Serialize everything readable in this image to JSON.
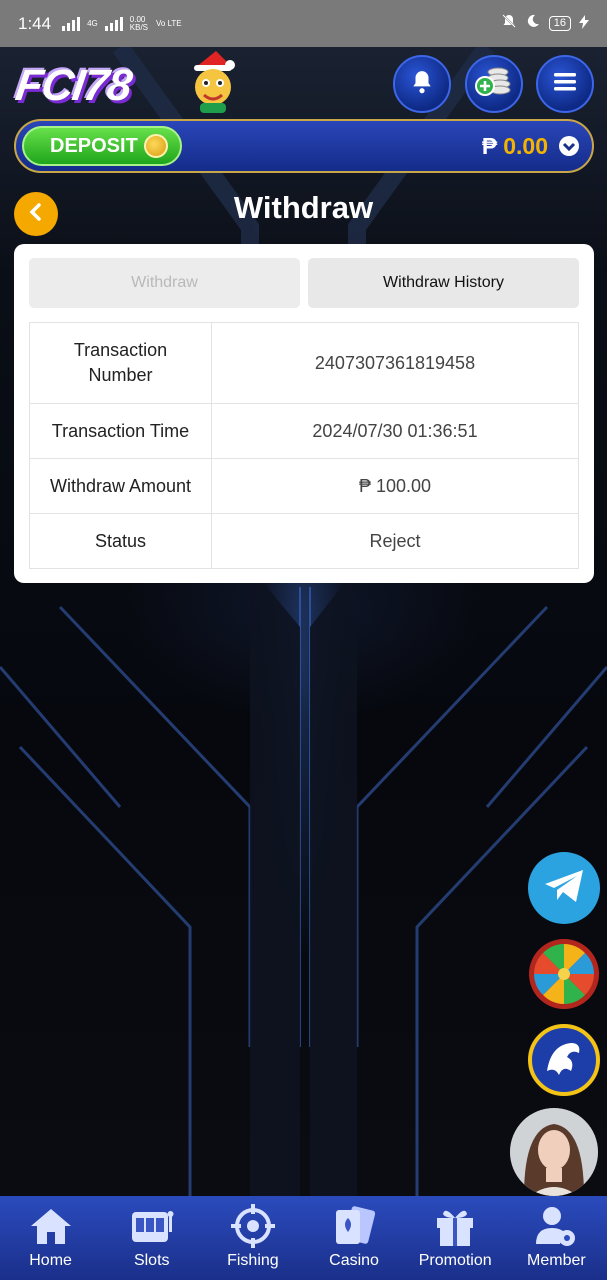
{
  "status_bar": {
    "time": "1:44",
    "net_type": "4G",
    "data_speed": "0.00",
    "data_unit": "KB/S",
    "volte": "Vo LTE",
    "battery": "16"
  },
  "header": {
    "logo_text": "FCI78",
    "icons": [
      "bell-icon",
      "add-coins-icon",
      "menu-icon"
    ]
  },
  "wallet": {
    "deposit_label": "DEPOSIT",
    "currency_symbol": "₱",
    "balance": "0.00"
  },
  "page": {
    "title": "Withdraw"
  },
  "tabs": [
    {
      "label": "Withdraw",
      "active": false
    },
    {
      "label": "Withdraw History",
      "active": true
    }
  ],
  "transaction": {
    "rows": [
      {
        "key": "Transaction Number",
        "value": "2407307361819458"
      },
      {
        "key": "Transaction Time",
        "value": "2024/07/30 01:36:51"
      },
      {
        "key": "Withdraw Amount",
        "value": "₱ 100.00"
      },
      {
        "key": "Status",
        "value": "Reject"
      }
    ]
  },
  "floating": [
    "telegram-icon",
    "lucky-wheel-icon",
    "dragon-icon",
    "live-chat-avatar"
  ],
  "bottom_nav": [
    {
      "label": "Home",
      "icon": "home-icon"
    },
    {
      "label": "Slots",
      "icon": "slot-machine-icon"
    },
    {
      "label": "Fishing",
      "icon": "crosshair-icon"
    },
    {
      "label": "Casino",
      "icon": "cards-icon"
    },
    {
      "label": "Promotion",
      "icon": "gift-icon"
    },
    {
      "label": "Member",
      "icon": "member-gear-icon"
    }
  ],
  "colors": {
    "accent_orange": "#f5a800",
    "balance_gold": "#f4b400",
    "nav_blue": "#2b4bbd",
    "deposit_green": "#1fa51c"
  }
}
